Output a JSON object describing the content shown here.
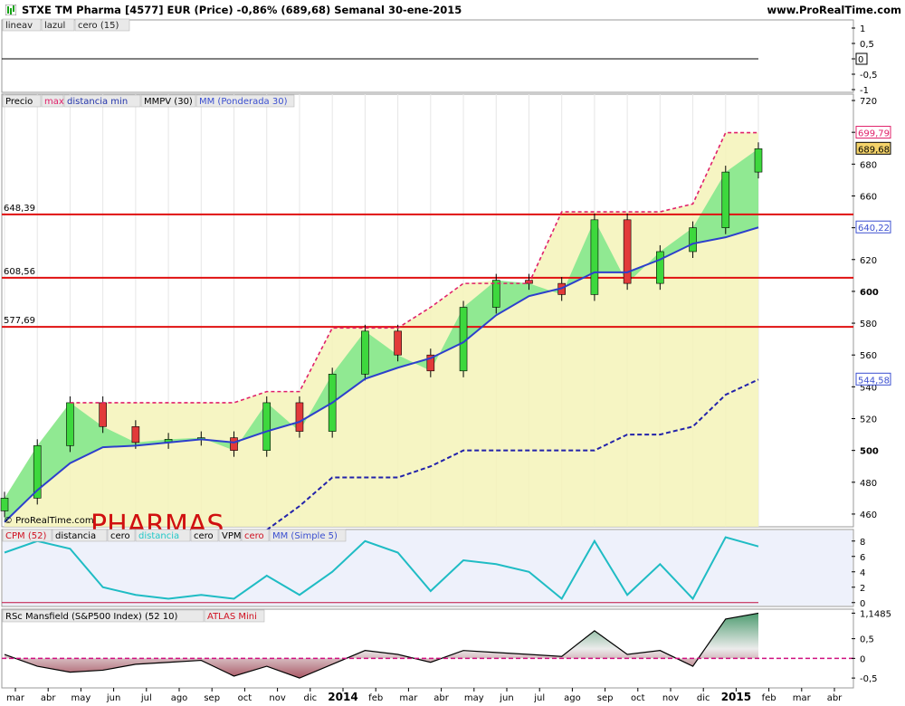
{
  "header": {
    "title": "STXE TM Pharma [4577] EUR (Price)   -0,86% (689,68)   Semanal   30-ene-2015",
    "brand": "www.ProRealTime.com"
  },
  "panels": {
    "top": {
      "legend": [
        "lineav",
        "lazul",
        "cero (15)"
      ],
      "y_ticks": [
        "1",
        "0,5",
        "0",
        "-0,5",
        "-1"
      ]
    },
    "price": {
      "legend": [
        {
          "text": "Precio",
          "color": "#000000"
        },
        {
          "text": "max",
          "color": "#e0206a"
        },
        {
          "text": "distancia min",
          "color": "#2233aa"
        },
        {
          "text": "MMPV (30)",
          "color": "#000000"
        },
        {
          "text": "MM (Ponderada 30)",
          "color": "#3b4fd0"
        }
      ],
      "y_ticks": [
        "720",
        "700",
        "680",
        "660",
        "640",
        "620",
        "600",
        "580",
        "560",
        "540",
        "520",
        "500",
        "480",
        "460"
      ],
      "hlines": [
        {
          "label": "648,39",
          "value": 648.39
        },
        {
          "label": "608,56",
          "value": 608.56
        },
        {
          "label": "577,69",
          "value": 577.69
        }
      ],
      "badges": [
        {
          "text": "699,79",
          "color": "#e0206a"
        },
        {
          "text": "689,68",
          "color": "#000000"
        },
        {
          "text": "640,22",
          "color": "#3b4fd0"
        },
        {
          "text": "544,58",
          "color": "#3b4fd0"
        }
      ],
      "watermark": "© ProRealTime.com",
      "overlay_text": "PHARMAS"
    },
    "cpm": {
      "legend": [
        {
          "text": "CPM (52)",
          "color": "#d01020"
        },
        {
          "text": "distancia",
          "color": "#000000"
        },
        {
          "text": "cero",
          "color": "#000000"
        },
        {
          "text": "distancia",
          "color": "#20c8c8"
        },
        {
          "text": "cero",
          "color": "#000000"
        },
        {
          "text": "VPM",
          "color": "#000000"
        },
        {
          "text": "cero",
          "color": "#d01020"
        },
        {
          "text": "MM (Simple 5)",
          "color": "#3b4fd0"
        }
      ],
      "y_ticks": [
        "8",
        "6",
        "4",
        "2",
        "0"
      ]
    },
    "rsc": {
      "legend": [
        {
          "text": "RSc Mansfield (S&P500 Index) (52 10)",
          "color": "#000000"
        },
        {
          "text": "ATLAS Mini",
          "color": "#d01020"
        }
      ],
      "y_ticks": [
        "1,1485",
        "0,5",
        "0",
        "-0,5"
      ]
    }
  },
  "x_axis": [
    "mar",
    "abr",
    "may",
    "jun",
    "jul",
    "ago",
    "sep",
    "oct",
    "nov",
    "dic",
    "2014",
    "feb",
    "mar",
    "abr",
    "may",
    "jun",
    "jul",
    "ago",
    "sep",
    "oct",
    "nov",
    "dic",
    "2015",
    "feb",
    "mar",
    "abr"
  ],
  "chart_data": [
    {
      "type": "line",
      "title": "STXE TM Pharma [4577] EUR (Price)",
      "period": "Semanal",
      "x": [
        "2013-03",
        "2013-04",
        "2013-05",
        "2013-06",
        "2013-07",
        "2013-08",
        "2013-09",
        "2013-10",
        "2013-11",
        "2013-12",
        "2014-01",
        "2014-02",
        "2014-03",
        "2014-04",
        "2014-05",
        "2014-06",
        "2014-07",
        "2014-08",
        "2014-09",
        "2014-10",
        "2014-11",
        "2014-12",
        "2015-01",
        "2015-01-30"
      ],
      "series": [
        {
          "name": "Precio",
          "values": [
            470,
            503,
            530,
            515,
            505,
            507,
            508,
            500,
            530,
            512,
            548,
            575,
            560,
            550,
            590,
            607,
            605,
            598,
            645,
            605,
            625,
            640,
            675,
            689.68
          ]
        },
        {
          "name": "MM (Ponderada 30)",
          "values": [
            455,
            475,
            492,
            502,
            503,
            505,
            507,
            505,
            512,
            518,
            530,
            545,
            552,
            558,
            568,
            585,
            597,
            602,
            612,
            612,
            620,
            630,
            634,
            640.22
          ]
        },
        {
          "name": "distancia min",
          "values": [
            null,
            null,
            null,
            null,
            null,
            null,
            null,
            null,
            450,
            465,
            483,
            483,
            483,
            490,
            500,
            500,
            500,
            500,
            500,
            510,
            510,
            515,
            535,
            544.58
          ]
        },
        {
          "name": "max",
          "values": [
            null,
            null,
            530,
            530,
            530,
            530,
            530,
            530,
            537,
            537,
            577,
            577,
            577,
            590,
            605,
            605,
            605,
            650,
            650,
            650,
            650,
            655,
            699.79,
            699.79
          ]
        }
      ],
      "hlines": [
        648.39,
        608.56,
        577.69
      ],
      "ylim": [
        452,
        724
      ]
    },
    {
      "type": "line",
      "title": "CPM (52)",
      "series": [
        {
          "name": "distancia",
          "values": [
            6.5,
            8,
            7,
            2,
            1,
            0.5,
            1,
            0.5,
            3.5,
            1,
            4,
            8,
            6.5,
            1.5,
            5.5,
            5,
            4,
            0.5,
            8,
            1,
            5,
            0.5,
            8.5,
            7.3
          ]
        }
      ],
      "ylim": [
        -0.5,
        9.5
      ]
    },
    {
      "type": "area",
      "title": "RSc Mansfield (S&P500 Index) (52 10)",
      "series": [
        {
          "name": "RSc Mansfield (S&P500 Index)",
          "values": [
            0.1,
            -0.2,
            -0.35,
            -0.3,
            -0.15,
            -0.1,
            -0.05,
            -0.45,
            -0.2,
            -0.5,
            -0.15,
            0.2,
            0.1,
            -0.1,
            0.2,
            0.15,
            0.1,
            0.05,
            0.7,
            0.1,
            0.2,
            -0.2,
            1.0,
            1.1485
          ]
        }
      ],
      "ylim": [
        -0.75,
        1.25
      ]
    }
  ]
}
